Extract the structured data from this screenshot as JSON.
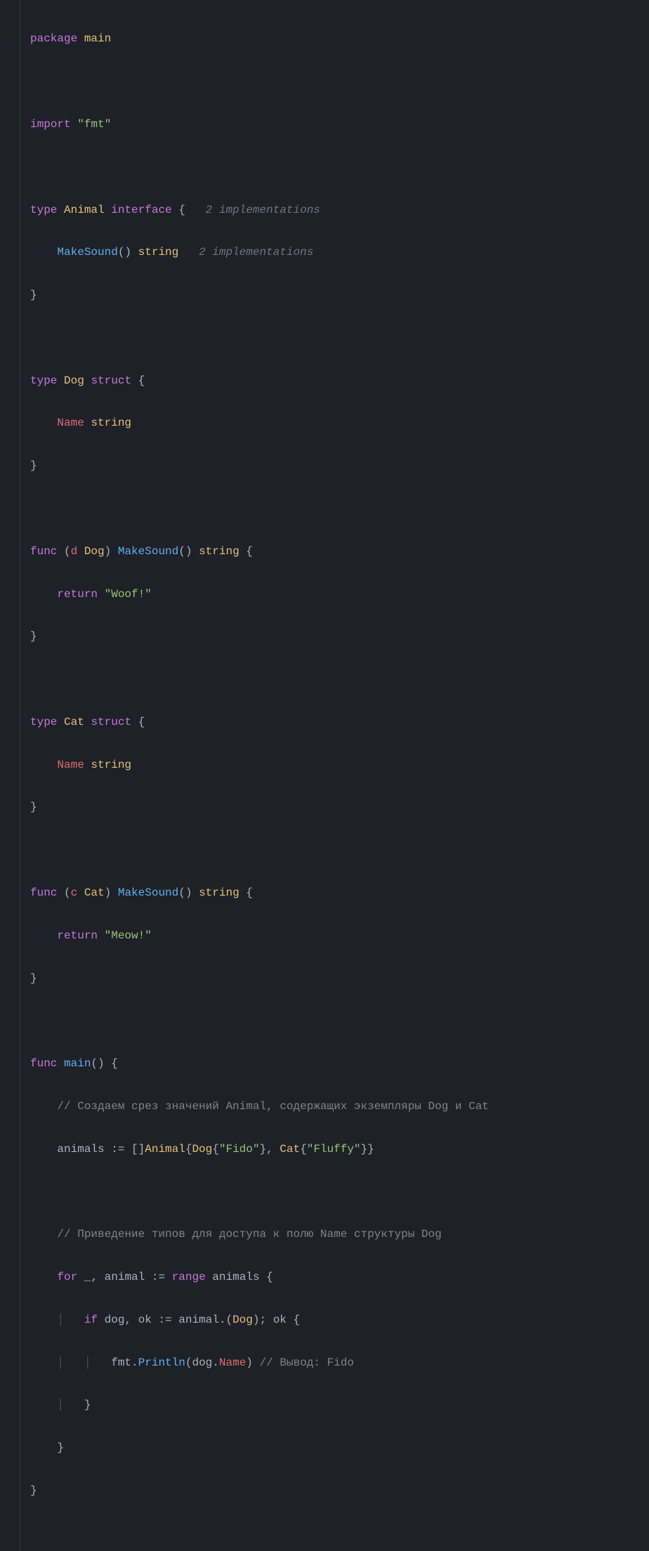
{
  "code": {
    "l1": {
      "kw_package": "package",
      "pkg": "main"
    },
    "l3": {
      "kw_import": "import",
      "str": "\"fmt\""
    },
    "l5": {
      "kw_type": "type",
      "name": "Animal",
      "kw_interface": "interface",
      "brace": " {",
      "hint": "2 implementations"
    },
    "l6": {
      "indent": "    ",
      "method": "MakeSound",
      "parens": "()",
      "ret": "string",
      "hint": "2 implementations"
    },
    "l7": {
      "brace": "}"
    },
    "l9": {
      "kw_type": "type",
      "name": "Dog",
      "kw_struct": "struct",
      "brace": " {"
    },
    "l10": {
      "indent": "    ",
      "field": "Name",
      "ftype": "string"
    },
    "l11": {
      "brace": "}"
    },
    "l13": {
      "kw_func": "func",
      "recv_open": " (",
      "recv_var": "d",
      "recv_type": "Dog",
      "recv_close": ") ",
      "method": "MakeSound",
      "parens": "()",
      "ret": "string",
      "brace": " {"
    },
    "l14": {
      "indent": "    ",
      "kw_return": "return",
      "str": "\"Woof!\""
    },
    "l15": {
      "brace": "}"
    },
    "l17": {
      "kw_type": "type",
      "name": "Cat",
      "kw_struct": "struct",
      "brace": " {"
    },
    "l18": {
      "indent": "    ",
      "field": "Name",
      "ftype": "string"
    },
    "l19": {
      "brace": "}"
    },
    "l21": {
      "kw_func": "func",
      "recv_open": " (",
      "recv_var": "c",
      "recv_type": "Cat",
      "recv_close": ") ",
      "method": "MakeSound",
      "parens": "()",
      "ret": "string",
      "brace": " {"
    },
    "l22": {
      "indent": "    ",
      "kw_return": "return",
      "str": "\"Meow!\""
    },
    "l23": {
      "brace": "}"
    },
    "l25": {
      "kw_func": "func",
      "name": "main",
      "parens": "()",
      "brace": " {"
    },
    "l26": {
      "indent": "    ",
      "comment": "// Создаем срез значений Animal, содержащих экземпляры Dog и Cat"
    },
    "l27": {
      "indent": "    ",
      "var": "animals",
      "op": " := []",
      "t1": "Animal",
      "b1": "{",
      "t2": "Dog",
      "b2": "{",
      "s1": "\"Fido\"",
      "b3": "}, ",
      "t3": "Cat",
      "b4": "{",
      "s2": "\"Fluffy\"",
      "b5": "}}"
    },
    "l29": {
      "indent": "    ",
      "comment": "// Приведение типов для доступа к полю Name структуры Dog"
    },
    "l30": {
      "indent": "    ",
      "kw_for": "for",
      "blank": "_",
      "comma": ", ",
      "var": "animal",
      "op": " := ",
      "kw_range": "range",
      "coll": "animals",
      "brace": " {"
    },
    "l31": {
      "indent": "    ",
      "guide": "│   ",
      "kw_if": "if",
      "v1": "dog",
      "comma": ", ",
      "v2": "ok",
      "op": " := ",
      "expr": "animal",
      "dot": ".(",
      "type": "Dog",
      "close": "); ",
      "cond": "ok",
      "brace": " {"
    },
    "l32": {
      "indent": "    ",
      "guide": "│   │   ",
      "pkg": "fmt",
      "dot": ".",
      "fn": "Println",
      "open": "(",
      "arg1": "dog",
      "dot2": ".",
      "arg2": "Name",
      "close": ")",
      "comment": " // Вывод: Fido"
    },
    "l33": {
      "indent": "    ",
      "guide": "│   ",
      "brace": "}"
    },
    "l34": {
      "indent": "    ",
      "brace": "}"
    },
    "l35": {
      "brace": "}"
    }
  }
}
